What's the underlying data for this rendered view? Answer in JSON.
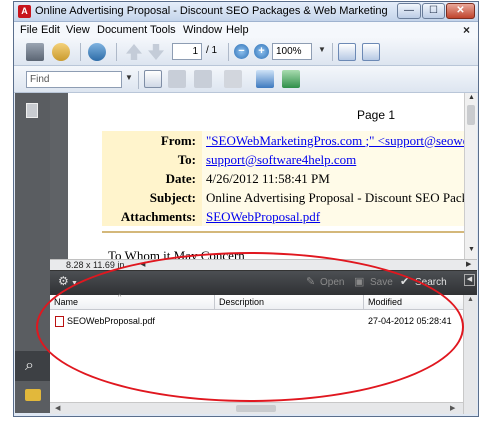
{
  "window": {
    "title": "Online Advertising Proposal - Discount SEO Packages & Web Marketing Services.pdf - A...",
    "app_icon_glyph": "A",
    "minimize_glyph": "—",
    "maximize_glyph": "☐",
    "close_glyph": "✕"
  },
  "menu": {
    "items": [
      "File",
      "Edit",
      "View",
      "Document",
      "Tools",
      "Window",
      "Help"
    ],
    "close_glyph": "×"
  },
  "toolbar": {
    "page_current": "1",
    "page_total": "/ 1",
    "zoom": "100%",
    "find_placeholder": "Find"
  },
  "document": {
    "page_label": "Page 1",
    "headers": [
      {
        "key": "From:",
        "value": "\"SEOWebMarketingPros.com ;\" <support@seoweb",
        "link": true
      },
      {
        "key": "To:",
        "value": "support@software4help.com",
        "link": true
      },
      {
        "key": "Date:",
        "value": "4/26/2012 11:58:41 PM",
        "link": false
      },
      {
        "key": "Subject:",
        "value": "Online Advertising Proposal - Discount SEO Packag",
        "link": false
      },
      {
        "key": "Attachments:",
        "value": "SEOWebProposal.pdf",
        "link": true
      }
    ],
    "greeting": "To Whom it May Concern",
    "page_size": "8.28 x 11.69 in"
  },
  "attachments": {
    "toolbar": {
      "open_label": "Open",
      "save_label": "Save",
      "search_label": "Search"
    },
    "columns": [
      "Name",
      "Description",
      "Modified"
    ],
    "rows": [
      {
        "name": "SEOWebProposal.pdf",
        "description": "",
        "modified": "27-04-2012 05:28:41"
      }
    ]
  },
  "colors": {
    "annotation": "#e0171f",
    "header_key_bg": "#fff4cc",
    "link": "#0000ee"
  }
}
